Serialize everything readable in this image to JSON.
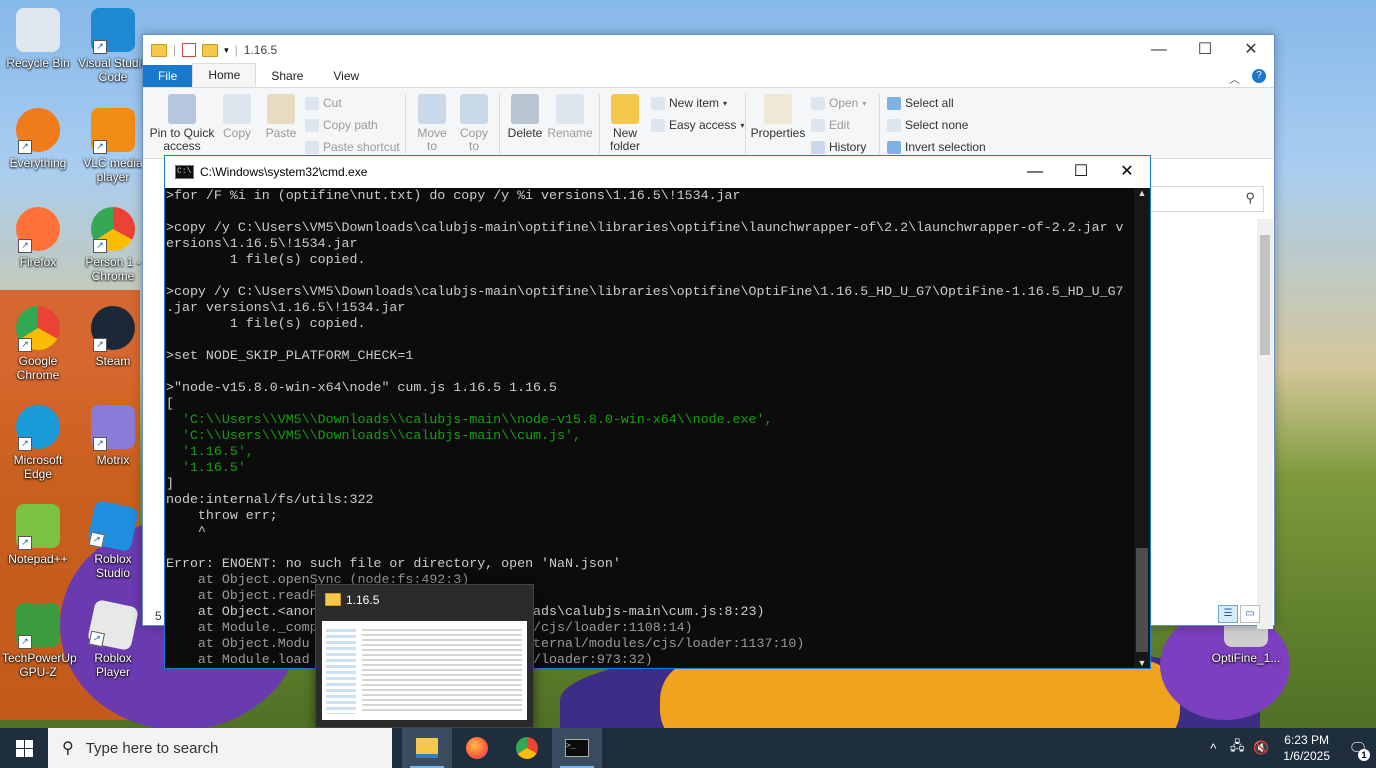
{
  "desktop": {
    "icons": [
      {
        "label": "Recycle Bin",
        "icon": "recycle-bin-icon",
        "color": "#dfe7ef"
      },
      {
        "label": "Visual Studio Code",
        "icon": "vscode-icon",
        "color": "#1f8ad2"
      },
      {
        "label": "Everything",
        "icon": "everything-icon",
        "color": "#f07b1a"
      },
      {
        "label": "VLC media player",
        "icon": "vlc-icon",
        "color": "#f28c12"
      },
      {
        "label": "Firefox",
        "icon": "firefox-icon",
        "color": "#ff7139"
      },
      {
        "label": "Person 1 - Chrome",
        "icon": "chrome-icon",
        "color": "#34a853"
      },
      {
        "label": "Google Chrome",
        "icon": "chrome-icon",
        "color": "#4285f4"
      },
      {
        "label": "Steam",
        "icon": "steam-icon",
        "color": "#1b2838"
      },
      {
        "label": "Microsoft Edge",
        "icon": "edge-icon",
        "color": "#1a9bd7"
      },
      {
        "label": "Motrix",
        "icon": "motrix-icon",
        "color": "#8a7bd8"
      },
      {
        "label": "Notepad++",
        "icon": "notepadpp-icon",
        "color": "#7cc242"
      },
      {
        "label": "Roblox Studio",
        "icon": "roblox-studio-icon",
        "color": "#1f8fe0"
      },
      {
        "label": "TechPowerUp GPU-Z",
        "icon": "gpuz-icon",
        "color": "#3c9b3c"
      },
      {
        "label": "Roblox Player",
        "icon": "roblox-player-icon",
        "color": "#e8e8e8"
      },
      {
        "label": "OptiFine_1...",
        "icon": "optifine-icon",
        "color": "#cfcfcf"
      }
    ]
  },
  "explorer": {
    "title": "1.16.5",
    "tabs": [
      "File",
      "Home",
      "Share",
      "View"
    ],
    "ribbon": {
      "pin": "Pin to Quick access",
      "copy": "Copy",
      "paste": "Paste",
      "cut": "Cut",
      "copy_path": "Copy path",
      "paste_shortcut": "Paste shortcut",
      "move_to": "Move to",
      "copy_to": "Copy to",
      "delete": "Delete",
      "rename": "Rename",
      "new_folder": "New folder",
      "new_item": "New item",
      "easy_access": "Easy access",
      "properties": "Properties",
      "open": "Open",
      "edit": "Edit",
      "history": "History",
      "select_all": "Select all",
      "select_none": "Select none",
      "invert_selection": "Invert selection"
    },
    "status_text": "5"
  },
  "cmd": {
    "title": "C:\\Windows\\system32\\cmd.exe",
    "lines": [
      {
        "t": ">for /F %i in (optifine\\nut.txt) do copy /y %i versions\\1.16.5\\!1534.jar",
        "c": ""
      },
      {
        "t": "",
        "c": ""
      },
      {
        "t": ">copy /y C:\\Users\\VM5\\Downloads\\calubjs-main\\optifine\\libraries\\optifine\\launchwrapper-of\\2.2\\launchwrapper-of-2.2.jar v",
        "c": ""
      },
      {
        "t": "ersions\\1.16.5\\!1534.jar",
        "c": ""
      },
      {
        "t": "        1 file(s) copied.",
        "c": ""
      },
      {
        "t": "",
        "c": ""
      },
      {
        "t": ">copy /y C:\\Users\\VM5\\Downloads\\calubjs-main\\optifine\\libraries\\optifine\\OptiFine\\1.16.5_HD_U_G7\\OptiFine-1.16.5_HD_U_G7",
        "c": ""
      },
      {
        "t": ".jar versions\\1.16.5\\!1534.jar",
        "c": ""
      },
      {
        "t": "        1 file(s) copied.",
        "c": ""
      },
      {
        "t": "",
        "c": ""
      },
      {
        "t": ">set NODE_SKIP_PLATFORM_CHECK=1",
        "c": ""
      },
      {
        "t": "",
        "c": ""
      },
      {
        "t": ">\"node-v15.8.0-win-x64\\node\" cum.js 1.16.5 1.16.5",
        "c": ""
      },
      {
        "t": "[",
        "c": ""
      },
      {
        "t": "  'C:\\\\Users\\\\VM5\\\\Downloads\\\\calubjs-main\\\\node-v15.8.0-win-x64\\\\node.exe',",
        "c": "green"
      },
      {
        "t": "  'C:\\\\Users\\\\VM5\\\\Downloads\\\\calubjs-main\\\\cum.js',",
        "c": "green"
      },
      {
        "t": "  '1.16.5',",
        "c": "green"
      },
      {
        "t": "  '1.16.5'",
        "c": "green"
      },
      {
        "t": "]",
        "c": ""
      },
      {
        "t": "node:internal/fs/utils:322",
        "c": ""
      },
      {
        "t": "    throw err;",
        "c": ""
      },
      {
        "t": "    ^",
        "c": ""
      },
      {
        "t": "",
        "c": ""
      },
      {
        "t": "Error: ENOENT: no such file or directory, open 'NaN.json'",
        "c": ""
      },
      {
        "t": "    at Object.openSync (node:fs:492:3)",
        "c": "dim"
      },
      {
        "t": "    at Object.readF",
        "c": "dim"
      },
      {
        "t": "    at Object.<anon                          oads\\calubjs-main\\cum.js:8:23)",
        "c": ""
      },
      {
        "t": "    at Module._comp                           /cjs/loader:1108:14)",
        "c": "dim"
      },
      {
        "t": "    at Object.Modu                            ternal/modules/cjs/loader:1137:10)",
        "c": "dim"
      },
      {
        "t": "    at Module.load                            /loader:973:32)",
        "c": "dim"
      }
    ]
  },
  "thumbnail": {
    "title": "1.16.5"
  },
  "taskbar": {
    "search_placeholder": "Type here to search",
    "time": "6:23 PM",
    "date": "1/6/2025",
    "notification_count": "1"
  }
}
